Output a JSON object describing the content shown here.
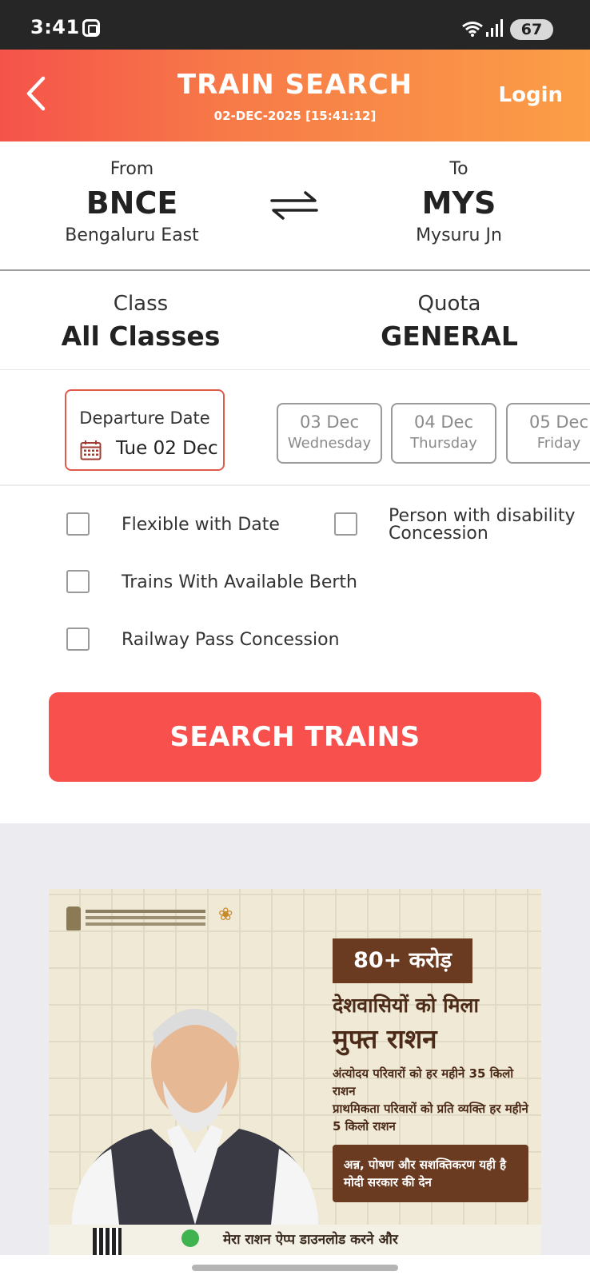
{
  "status_bar": {
    "time": "3:41",
    "battery": "67"
  },
  "header": {
    "title": "TRAIN SEARCH",
    "datetime": "02-DEC-2025 [15:41:12]",
    "login": "Login",
    "gradient_start": "#f5534a",
    "gradient_end": "#fb9e47"
  },
  "route": {
    "from": {
      "label": "From",
      "code": "BNCE",
      "name": "Bengaluru East"
    },
    "to": {
      "label": "To",
      "code": "MYS",
      "name": "Mysuru Jn"
    }
  },
  "class_quota": {
    "class_label": "Class",
    "class_value": "All Classes",
    "quota_label": "Quota",
    "quota_value": "GENERAL"
  },
  "dates": {
    "departure_label": "Departure Date",
    "departure_value": "Tue 02 Dec",
    "chips": [
      {
        "date": "03 Dec",
        "day": "Wednesday"
      },
      {
        "date": "04 Dec",
        "day": "Thursday"
      },
      {
        "date": "05 Dec",
        "day": "Friday"
      }
    ]
  },
  "options": {
    "flexible": "Flexible with Date",
    "disability_line1": "Person with disability",
    "disability_line2": "Concession",
    "available_berth": "Trains With Available Berth",
    "railway_pass": "Railway Pass Concession"
  },
  "search_button": "SEARCH TRAINS",
  "accent_color": "#f8514d",
  "ad": {
    "badge": "80+ करोड़",
    "line1": "देशवासियों को मिला",
    "line2": "मुफ्त राशन",
    "sub1": "अंत्योदय परिवारों को हर महीने 35 किलो राशन",
    "sub2": "प्राथमिकता परिवारों को प्रति व्यक्ति हर महीने 5 किलो राशन",
    "box_text": "अन्न, पोषण और सशक्तिकरण यही है मोदी सरकार की देन",
    "bottom_text": "मेरा राशन ऐप्प डाउनलोड करने और"
  }
}
